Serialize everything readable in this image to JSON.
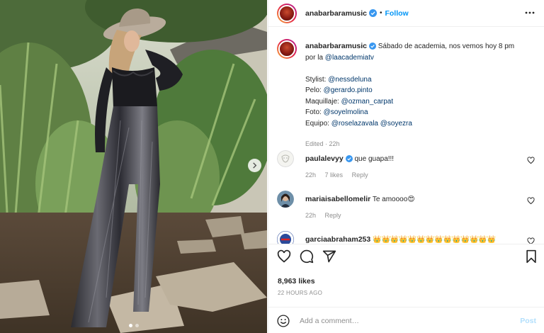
{
  "post": {
    "username": "anabarbaramusic",
    "follow_label": "Follow",
    "separator": "•",
    "caption": {
      "intro": "Sábado de academia, nos vemos hoy 8 pm por la ",
      "intro_mention": "@laacademiatv",
      "credits": [
        {
          "label": "Stylist: ",
          "mentions": [
            "@nessdeluna"
          ]
        },
        {
          "label": "Pelo: ",
          "mentions": [
            "@gerardo.pinto"
          ]
        },
        {
          "label": "Maquillaje: ",
          "mentions": [
            "@ozman_carpat"
          ]
        },
        {
          "label": "Foto: ",
          "mentions": [
            "@soyelmolina"
          ]
        },
        {
          "label": "Equipo: ",
          "mentions": [
            "@roselazavala",
            "@soyezra"
          ]
        }
      ],
      "edited": "Edited · 22h"
    },
    "comments": [
      {
        "username": "paulalevyy",
        "verified": true,
        "text": "que guapa!!!",
        "time": "22h",
        "likes": "7 likes",
        "reply": "Reply"
      },
      {
        "username": "mariaisabellomelir",
        "verified": false,
        "text": "Te amoooo😍",
        "time": "22h",
        "reply": "Reply"
      },
      {
        "username": "garciaabraham253",
        "verified": false,
        "text": "👑👑👑👑👑👑👑👑👑👑👑👑👑👑",
        "time": "",
        "reply": ""
      }
    ],
    "likes": "8,963 likes",
    "time_ago": "22 HOURS AGO",
    "add_comment": {
      "placeholder": "Add a comment…",
      "post_label": "Post"
    },
    "carousel": {
      "current": 1,
      "total": 2
    }
  },
  "colors": {
    "accent": "#0095f6",
    "mention": "#00376b",
    "muted": "#8e8e8e",
    "post_disabled": "#b2dffc"
  },
  "icons": [
    "verified-badge-icon",
    "more-options-icon",
    "heart-icon",
    "comment-icon",
    "share-icon",
    "bookmark-icon",
    "emoji-icon",
    "chevron-right-icon"
  ]
}
